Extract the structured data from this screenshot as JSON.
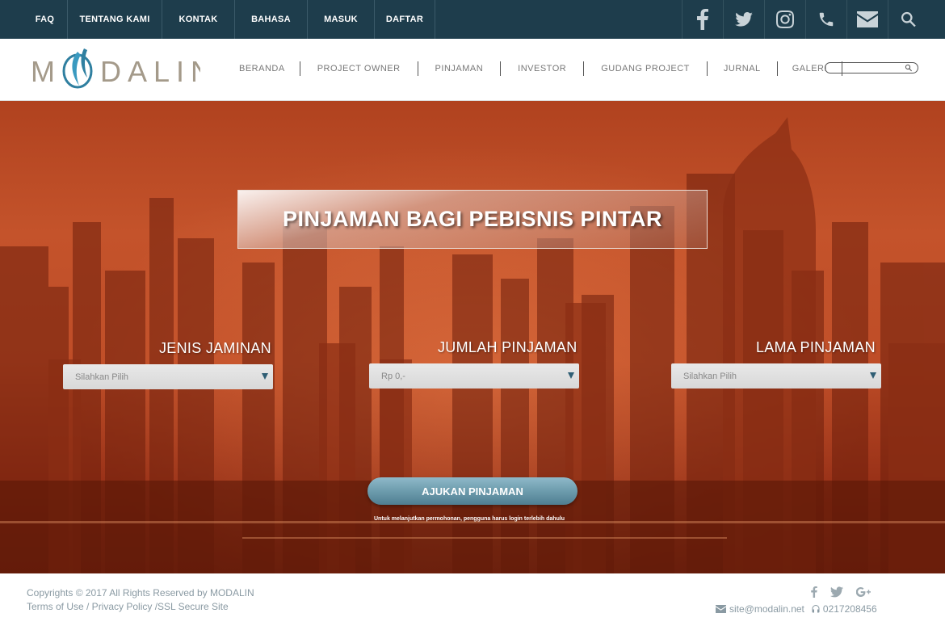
{
  "topbar": {
    "nav": [
      "FAQ",
      "TENTANG KAMI",
      "KONTAK",
      "BAHASA",
      "MASUK",
      "DAFTAR"
    ],
    "icons": [
      "facebook-icon",
      "twitter-icon",
      "instagram-icon",
      "phone-icon",
      "mail-icon",
      "search-icon"
    ]
  },
  "header": {
    "logo_text": "M DALIN",
    "nav": [
      "BERANDA",
      "PROJECT OWNER",
      "PINJAMAN",
      "INVESTOR",
      "GUDANG PROJECT",
      "JURNAL",
      "GALERI"
    ]
  },
  "hero": {
    "banner_title": "PINJAMAN BAGI PEBISNIS PINTAR",
    "fields": [
      {
        "label": "JENIS JAMINAN",
        "placeholder": "Silahkan Pilih"
      },
      {
        "label": "JUMLAH PINJAMAN",
        "placeholder": "Rp 0,-"
      },
      {
        "label": "LAMA PINJAMAN",
        "placeholder": "Silahkan Pilih"
      }
    ],
    "submit_label": "AJUKAN PINJAMAN",
    "note": "Untuk melanjutkan permohonan, pengguna harus login terlebih dahulu"
  },
  "footer": {
    "copyright": "Copyrights © 2017 All Rights Reserved by MODALIN",
    "links": "Terms of Use / Privacy Policy /SSL Secure Site",
    "email": "site@modalin.net",
    "phone": "0217208456"
  },
  "colors": {
    "topbar": "#1e3d4c",
    "accent": "#2f7fa0",
    "hero": "#c4532b"
  }
}
